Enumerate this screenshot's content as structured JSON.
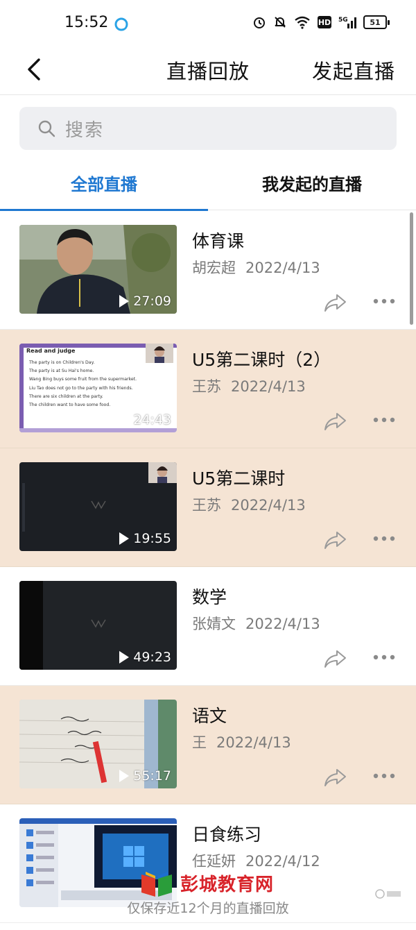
{
  "status_bar": {
    "time": "15:52",
    "battery": "51",
    "network": "5G",
    "hd": "HD"
  },
  "nav": {
    "title": "直播回放",
    "action_label": "发起直播"
  },
  "search": {
    "placeholder": "搜索"
  },
  "tabs": [
    {
      "label": "全部直播",
      "active": true
    },
    {
      "label": "我发起的直播",
      "active": false
    }
  ],
  "items": [
    {
      "title": "体育课",
      "author": "胡宏超",
      "date": "2022/4/13",
      "duration": "27:09",
      "bg": "white",
      "thumb": "outdoor-selfie"
    },
    {
      "title": "U5第二课时（2）",
      "author": "王苏",
      "date": "2022/4/13",
      "duration": "24:43",
      "bg": "tan",
      "thumb": "slide"
    },
    {
      "title": "U5第二课时",
      "author": "王苏",
      "date": "2022/4/13",
      "duration": "19:55",
      "bg": "tan",
      "thumb": "dark-screen"
    },
    {
      "title": "数学",
      "author": "张婧文",
      "date": "2022/4/13",
      "duration": "49:23",
      "bg": "white",
      "thumb": "dark-screen"
    },
    {
      "title": "语文",
      "author": "王",
      "date": "2022/4/13",
      "duration": "55:17",
      "bg": "tan",
      "thumb": "notebook"
    },
    {
      "title": "日食练习",
      "author": "任延妍",
      "date": "2022/4/12",
      "duration": "",
      "bg": "white",
      "thumb": "desktop"
    }
  ],
  "slide_thumb": {
    "heading": "Read and judge",
    "lines": [
      "The party is on Children's Day.",
      "The party is at Su Hai's home.",
      "Wang Bing buys some fruit from the supermarket.",
      "Liu Tao does not go to the party with his friends.",
      "There are six children at the party.",
      "The children want to have some food."
    ]
  },
  "footer_note": "仅保存近12个月的直播回放",
  "watermark": "彭城教育网",
  "colors": {
    "accent": "#1f78d1",
    "highlight_row": "#f5e4d4"
  }
}
